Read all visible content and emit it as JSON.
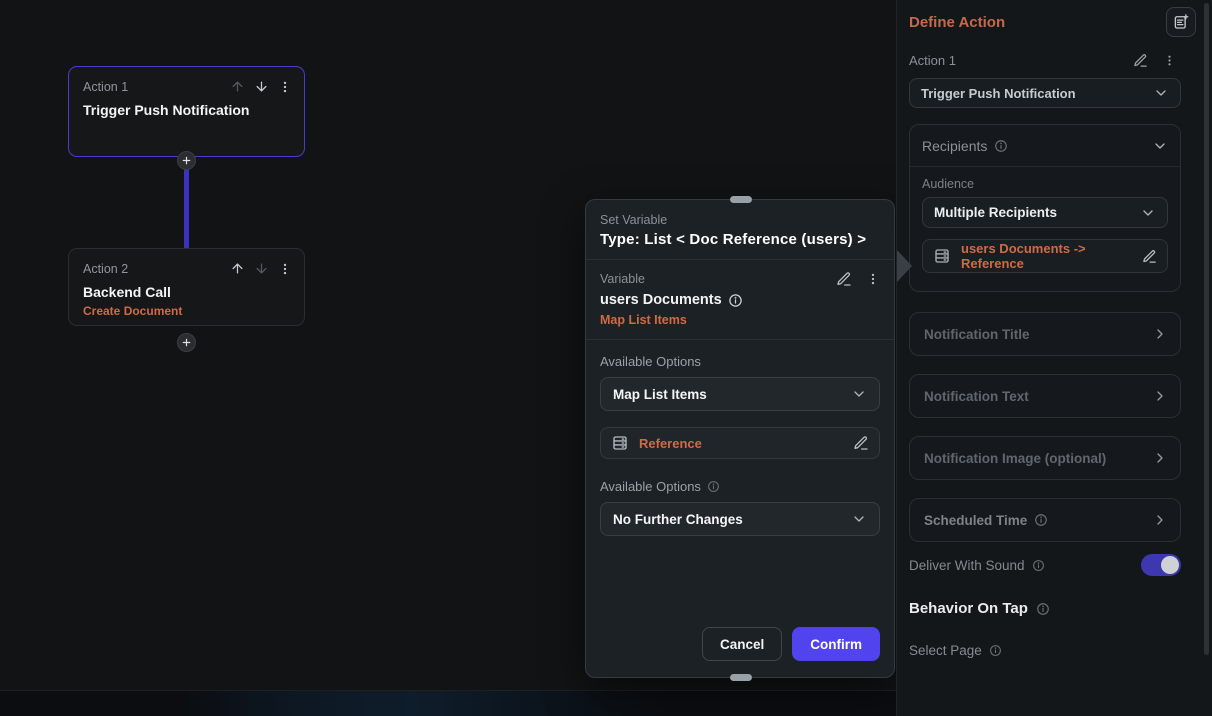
{
  "canvas": {
    "nodes": [
      {
        "label": "Action 1",
        "title": "Trigger Push Notification",
        "subtitle": ""
      },
      {
        "label": "Action 2",
        "title": "Backend Call",
        "subtitle": "Create Document"
      }
    ]
  },
  "modal": {
    "kicker": "Set Variable",
    "title": "Type: List < Doc Reference (users) >",
    "variable": {
      "label": "Variable",
      "name": "users Documents",
      "mode": "Map List Items"
    },
    "options1": {
      "label": "Available Options",
      "value": "Map List Items"
    },
    "reference_label": "Reference",
    "options2": {
      "label": "Available Options",
      "value": "No Further Changes"
    },
    "cancel_label": "Cancel",
    "confirm_label": "Confirm"
  },
  "panel": {
    "title": "Define Action",
    "action": {
      "label": "Action 1",
      "type_value": "Trigger Push Notification"
    },
    "recipients": {
      "title": "Recipients",
      "audience_label": "Audience",
      "audience_value": "Multiple Recipients",
      "reference_value": "users Documents -> Reference"
    },
    "collapsed_sections": [
      {
        "label": "Notification Title"
      },
      {
        "label": "Notification Text"
      },
      {
        "label": "Notification Image (optional)"
      },
      {
        "label": "Scheduled Time"
      }
    ],
    "deliver_with_sound": {
      "label": "Deliver With Sound",
      "enabled": true
    },
    "behavior_heading": "Behavior On Tap",
    "select_page_label": "Select Page"
  },
  "icons": [
    "add-note-icon",
    "edit-pencil-icon",
    "more-options-icon",
    "move-up-icon",
    "move-down-icon",
    "add-action-icon",
    "chevron-down-icon",
    "chevron-right-icon",
    "info-icon",
    "database-icon",
    "drag-handle",
    "toggle-switch"
  ],
  "colors": {
    "accent_orange": "#c8684a",
    "accent_orange_bright": "#d06a45",
    "accent_purple": "#473bd2",
    "confirm_purple": "#5143ee",
    "toggle_purple": "#3d37b0"
  }
}
